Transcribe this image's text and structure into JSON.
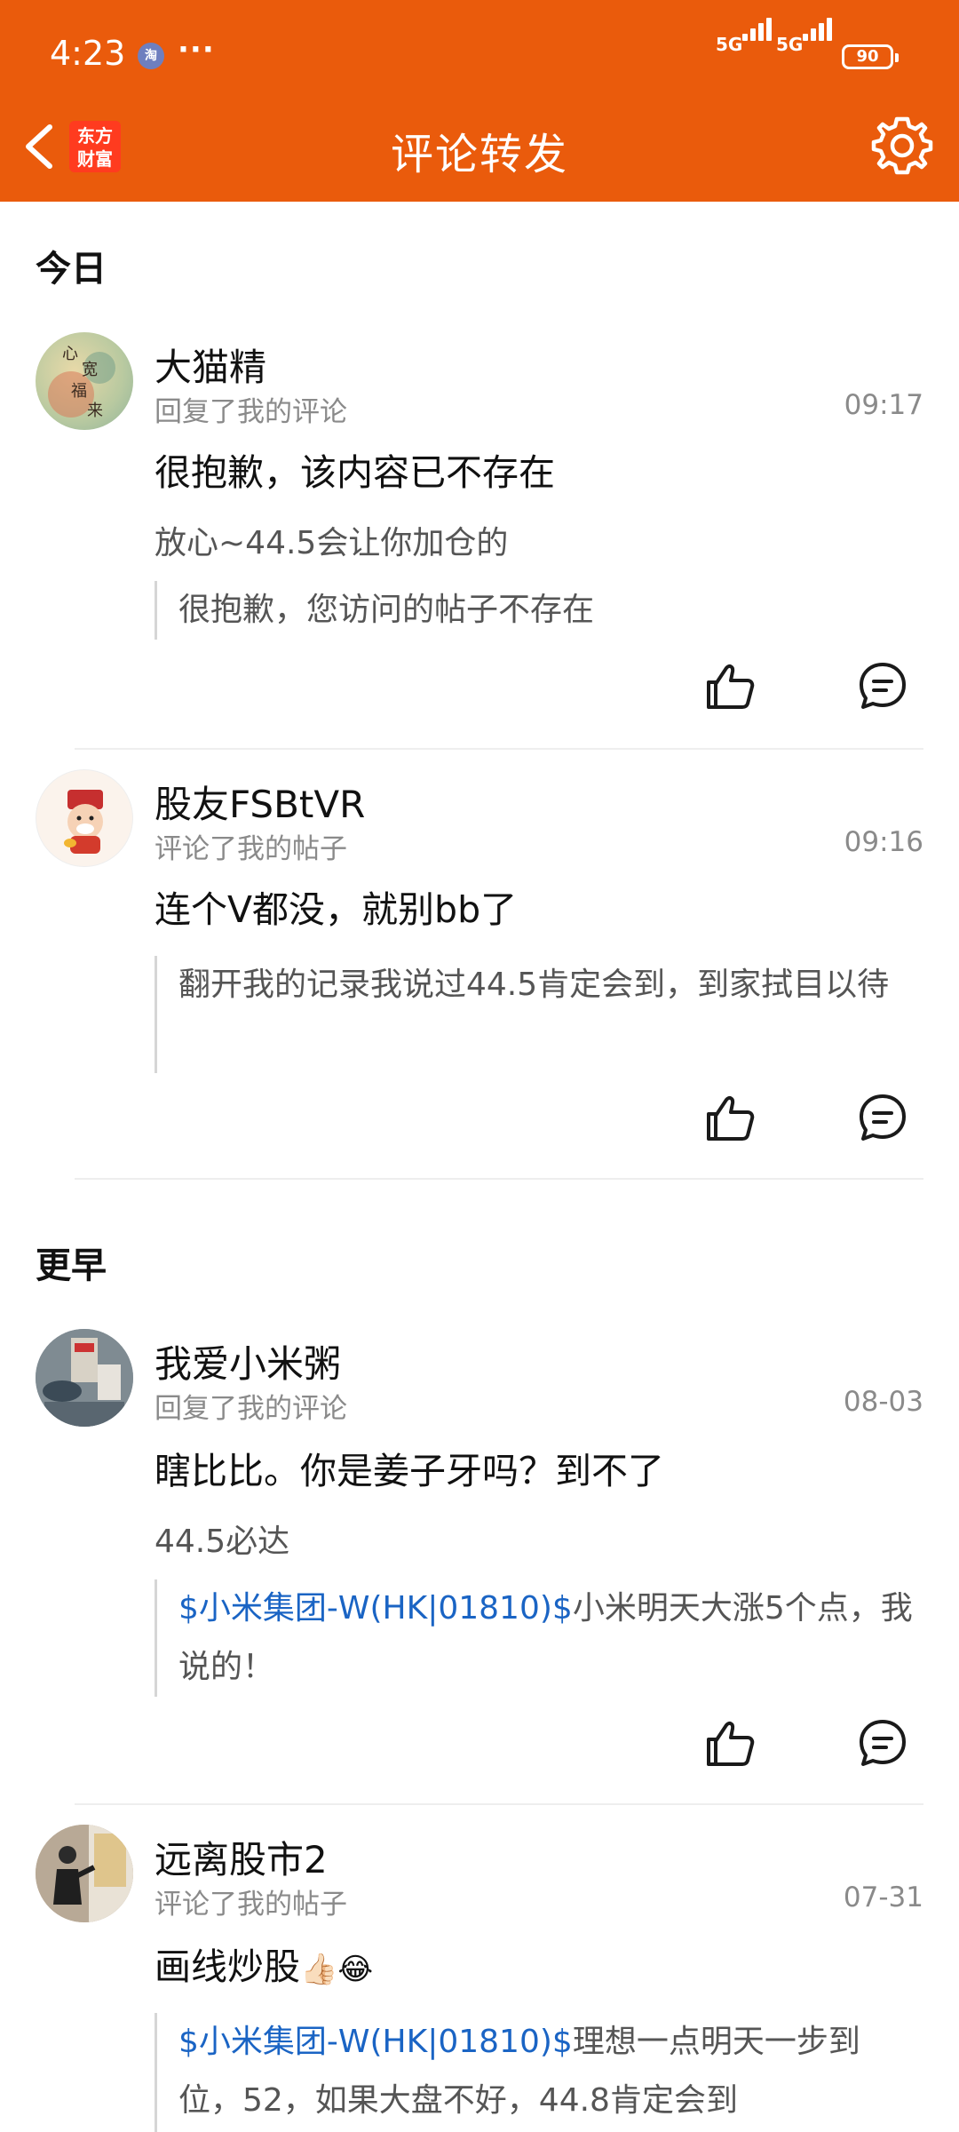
{
  "status_bar": {
    "time": "4:23",
    "app_icon": "淘",
    "more": "···",
    "network1": "5G",
    "network2": "5G",
    "battery": "90"
  },
  "header": {
    "logo_line1": "东方",
    "logo_line2": "财富",
    "title": "评论转发",
    "back_icon": "chevron-left",
    "settings_icon": "gear"
  },
  "sections": {
    "today": "今日",
    "earlier": "更早"
  },
  "items": [
    {
      "username": "大猫精",
      "action": "回复了我的评论",
      "time": "09:17",
      "main_text": " 很抱歉，该内容已不存在",
      "sub_text": "放心~44.5会让你加仓的",
      "quote": "很抱歉，您访问的帖子不存在"
    },
    {
      "username": "股友FSBtVR",
      "action": "评论了我的帖子",
      "time": "09:16",
      "main_text": "连个V都没，就别bb了",
      "quote": "翻开我的记录我说过44.5肯定会到，到家拭目以待"
    },
    {
      "username": "我爱小米粥",
      "action": "回复了我的评论",
      "time": "08-03",
      "main_text": "瞎比比。你是姜子牙吗？到不了",
      "sub_text": "44.5必达",
      "quote_link": "$小米集团-W(HK|01810)$",
      "quote_text": "小米明天大涨5个点，我说的！"
    },
    {
      "username": "远离股市2",
      "action": "评论了我的帖子",
      "time": "07-31",
      "main_text": "画线炒股",
      "main_emoji": "👍🏻😂",
      "quote_link": "$小米集团-W(HK|01810)$",
      "quote_text": "理想一点明天一步到位，52，如果大盘不好，44.8肯定会到"
    }
  ],
  "colors": {
    "header_bg": "#ea5b0c",
    "link": "#1a64c4",
    "secondary_text": "#8a8a8a"
  }
}
